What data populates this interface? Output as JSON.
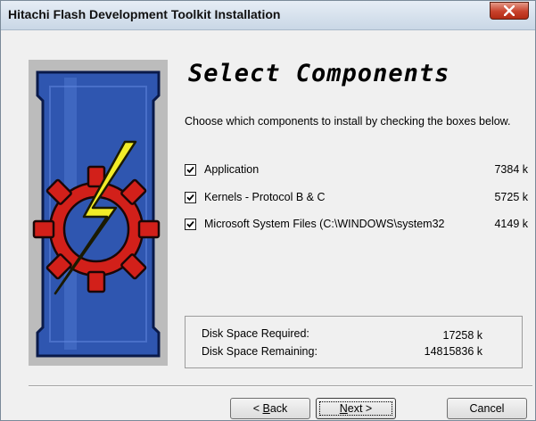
{
  "window": {
    "title": "Hitachi Flash Development Toolkit Installation"
  },
  "header": {
    "heading": "Select Components",
    "instructions": "Choose which components to install by checking the boxes below."
  },
  "components": [
    {
      "name": "Application",
      "size": "7384 k",
      "checked": true
    },
    {
      "name": "Kernels - Protocol B & C",
      "size": "5725 k",
      "checked": true
    },
    {
      "name": "Microsoft System Files (C:\\WINDOWS\\system32",
      "size": "4149 k",
      "checked": true
    }
  ],
  "disk_space": {
    "required_label": "Disk Space Required:",
    "required_value": "17258 k",
    "remaining_label": "Disk Space Remaining:",
    "remaining_value": "14815836 k"
  },
  "buttons": {
    "back_prefix": "< ",
    "back_mnemonic": "B",
    "back_rest": "ack",
    "next_mnemonic": "N",
    "next_rest": "ext >",
    "cancel": "Cancel"
  },
  "colors": {
    "titlebar": "#c9d7e6",
    "close_button": "#c8412b",
    "logo_panel": "#2f56b0",
    "gear": "#d2201a",
    "bolt": "#f2ec28"
  },
  "icons": {
    "close": "close-icon",
    "checkbox": "checkmark-icon",
    "logo": "gear-lightning-logo"
  }
}
